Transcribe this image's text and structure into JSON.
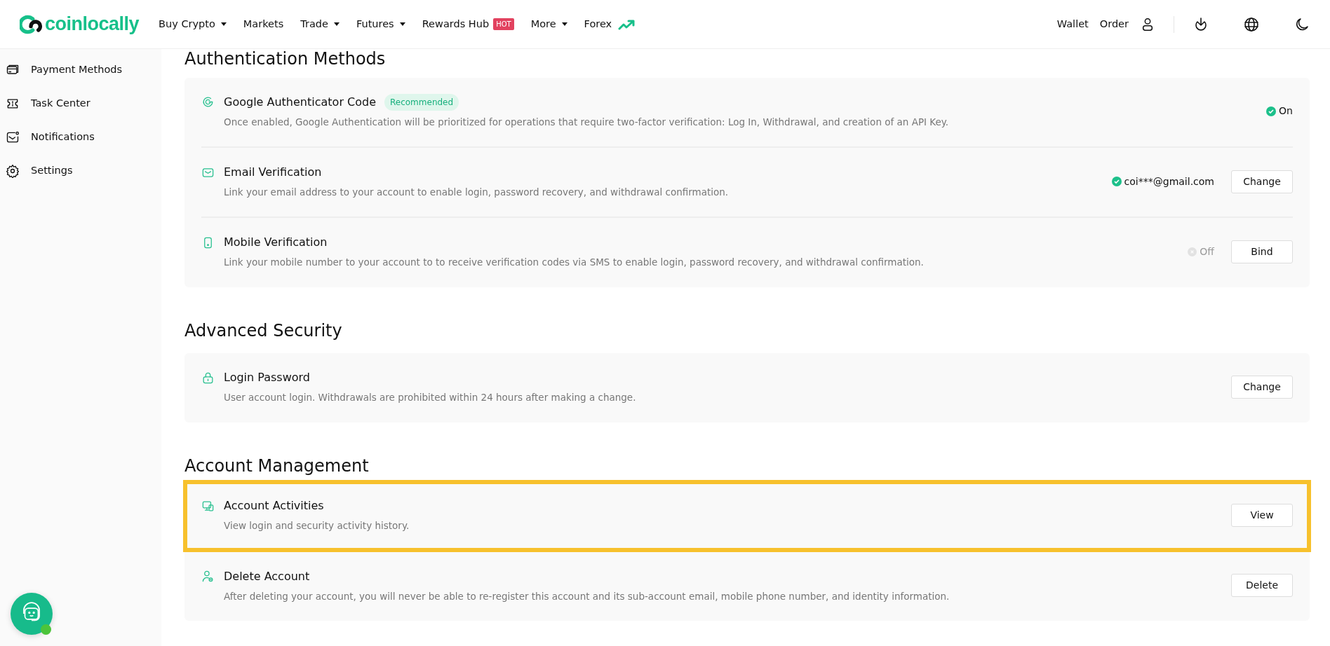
{
  "nav": {
    "logo": "coinlocally",
    "items": [
      {
        "label": "Buy Crypto",
        "dropdown": true
      },
      {
        "label": "Markets",
        "dropdown": false
      },
      {
        "label": "Trade",
        "dropdown": true
      },
      {
        "label": "Futures",
        "dropdown": true
      },
      {
        "label": "Rewards Hub",
        "dropdown": false,
        "badge": "HOT"
      },
      {
        "label": "More",
        "dropdown": true
      },
      {
        "label": "Forex",
        "dropdown": false,
        "trend": true
      }
    ],
    "links": [
      "Wallet",
      "Order"
    ]
  },
  "sidebar": {
    "items": [
      {
        "label": "Payment Methods"
      },
      {
        "label": "Task Center"
      },
      {
        "label": "Notifications"
      },
      {
        "label": "Settings"
      }
    ]
  },
  "sections": [
    {
      "title": "Authentication Methods",
      "items": [
        {
          "title": "Google Authenticator Code",
          "badge": "Recommended",
          "description": "Once enabled, Google Authentication will be prioritized for operations that require two-factor verification: Log In, Withdrawal, and creation of an API Key.",
          "status": {
            "text": "On",
            "on": true
          },
          "highlighted": false
        },
        {
          "title": "Email Verification",
          "description": "Link your email address to your account to enable login, password recovery, and withdrawal confirmation.",
          "status": {
            "text": "coi***@gmail.com",
            "on": true
          },
          "button": "Change",
          "highlighted": false
        },
        {
          "title": "Mobile Verification",
          "description": "Link your mobile number to your account to to receive verification codes via SMS to enable login, password recovery, and withdrawal confirmation.",
          "status": {
            "text": "Off",
            "on": false
          },
          "button": "Bind",
          "highlighted": false
        }
      ]
    },
    {
      "title": "Advanced Security",
      "items": [
        {
          "title": "Login Password",
          "description": "User account login. Withdrawals are prohibited within 24 hours after making a change.",
          "button": "Change",
          "highlighted": false
        }
      ]
    },
    {
      "title": "Account Management",
      "items": [
        {
          "title": "Account Activities",
          "description": "View login and security activity history.",
          "button": "View",
          "highlighted": true
        },
        {
          "title": "Delete Account",
          "description": "After deleting your account, you will never be able to re-register this account and its sub-account email, mobile phone number, and identity information.",
          "button": "Delete",
          "highlighted": false
        }
      ]
    }
  ],
  "support": {
    "online": true
  }
}
